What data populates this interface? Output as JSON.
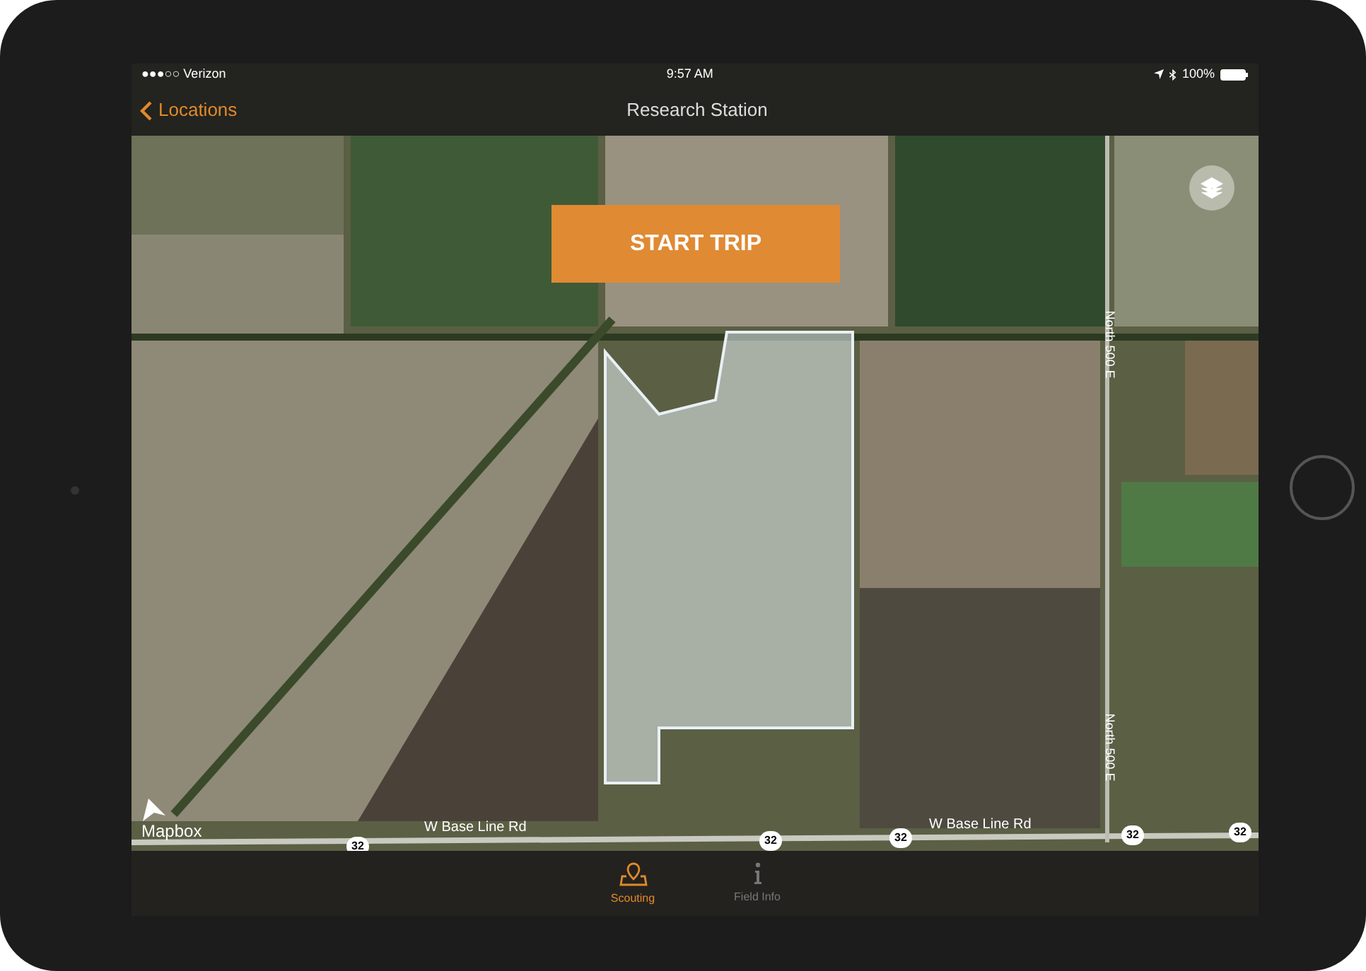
{
  "status_bar": {
    "carrier": "●●●○○ Verizon",
    "time": "9:57 AM",
    "battery": "100%"
  },
  "nav_bar": {
    "back": "Locations",
    "title": "Research Station"
  },
  "map": {
    "start_button": "START TRIP",
    "attribution": "Mapbox",
    "labels": [
      {
        "kind": "shield",
        "text": "32"
      },
      {
        "kind": "road",
        "text": "W Base Line Rd"
      },
      {
        "kind": "shield",
        "text": "32"
      },
      {
        "kind": "shield",
        "text": "32"
      },
      {
        "kind": "road",
        "text": "W Base Line Rd"
      },
      {
        "kind": "shield",
        "text": "32"
      },
      {
        "kind": "shield",
        "text": "32"
      },
      {
        "kind": "road_vertical",
        "text": "North 500 E"
      },
      {
        "kind": "road_vertical",
        "text": "North 500 E"
      }
    ]
  },
  "tabs": [
    {
      "label": "Scouting",
      "selected": true,
      "kind": "map"
    },
    {
      "label": "Field Info",
      "selected": false,
      "kind": "info"
    }
  ]
}
